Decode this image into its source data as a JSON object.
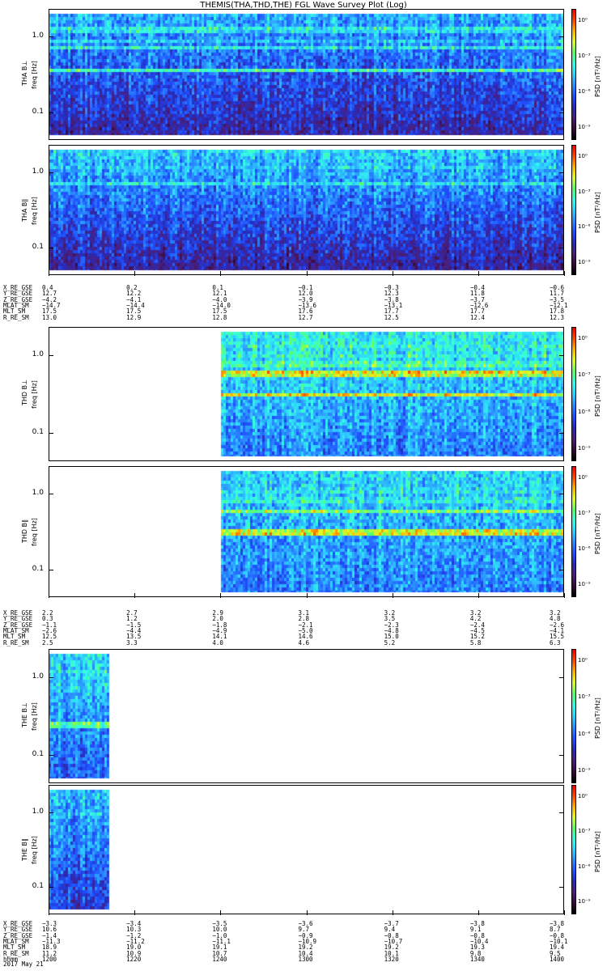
{
  "title": "THEMIS(THA,THD,THE) FGL Wave Survey Plot (Log)",
  "colors": {
    "colormap": [
      "#000000",
      "#3a0a3a",
      "#4b1f7a",
      "#2a2ab8",
      "#1f4fff",
      "#2b8cff",
      "#2fd0ff",
      "#34ffe0",
      "#5cff6a",
      "#d8ff2a",
      "#ffb400",
      "#ff4a00",
      "#ee0000"
    ]
  },
  "chart_data": {
    "type": "heatmap",
    "freq_scale": "log",
    "freq_range_hz": [
      0.05,
      2.0
    ],
    "freq_ticks": [
      {
        "value": 1.0,
        "label": "1.0"
      },
      {
        "value": 0.1,
        "label": "0.1"
      }
    ],
    "colorbar": {
      "label": "PSD [nT²/Hz]",
      "ticks": [
        {
          "value": 1,
          "label": "10⁰"
        },
        {
          "value": 0.001,
          "label": "10⁻³"
        },
        {
          "value": 1e-06,
          "label": "10⁻⁶"
        },
        {
          "value": 1e-09,
          "label": "10⁻⁹"
        }
      ]
    },
    "time_axis": {
      "date": "2017 May 21",
      "labels": [
        "1200",
        "1220",
        "1240",
        "1300",
        "1320",
        "1340",
        "1400"
      ]
    },
    "probes": [
      {
        "name": "THA",
        "panels": [
          {
            "ylabel": "THA B⊥",
            "freq_label": "freq [Hz]",
            "coverage": [
              0.0,
              1.0
            ],
            "bands": [
              {
                "f": 0.38,
                "level": 0.62
              },
              {
                "f": 0.75,
                "level": 0.55
              },
              {
                "f": 1.3,
                "level": 0.58
              },
              {
                "f": 0.9,
                "level": 0.5
              }
            ],
            "base_high": 0.46,
            "base_low": 0.22
          },
          {
            "ylabel": "THA B∥",
            "freq_label": "freq [Hz]",
            "coverage": [
              0.0,
              1.0
            ],
            "bands": [
              {
                "f": 0.75,
                "level": 0.55
              },
              {
                "f": 1.2,
                "level": 0.52
              }
            ],
            "base_high": 0.5,
            "base_low": 0.2
          }
        ],
        "ephemeris": [
          {
            "label": "X_RE_GSE",
            "values": [
              "0.4",
              "0.2",
              "0.1",
              "−0.1",
              "−0.3",
              "−0.4",
              "−0.6"
            ]
          },
          {
            "label": "Y_RE_GSE",
            "values": [
              "12.7",
              "12.2",
              "12.1",
              "12.0",
              "12.3",
              "11.8",
              "11.7"
            ]
          },
          {
            "label": "Z_RE_GSE",
            "values": [
              "−4.2",
              "−4.1",
              "−4.0",
              "−3.9",
              "−3.8",
              "−3.7",
              "−3.5"
            ]
          },
          {
            "label": "MLAT_SM",
            "values": [
              "−14.7",
              "−14.4",
              "−14.0",
              "−13.6",
              "−13.1",
              "−12.6",
              "−12.1"
            ]
          },
          {
            "label": "MLT_SM",
            "values": [
              "17.5",
              "17.5",
              "17.5",
              "17.6",
              "17.7",
              "17.7",
              "17.8"
            ]
          },
          {
            "label": "R_RE_SM",
            "values": [
              "13.0",
              "12.9",
              "12.8",
              "12.7",
              "12.5",
              "12.4",
              "12.3"
            ]
          }
        ]
      },
      {
        "name": "THD",
        "panels": [
          {
            "ylabel": "THD B⊥",
            "freq_label": "freq [Hz]",
            "coverage": [
              0.335,
              1.0
            ],
            "bands": [
              {
                "f": 0.32,
                "level": 0.78
              },
              {
                "f": 0.62,
                "level": 0.8
              },
              {
                "f": 0.8,
                "level": 0.65
              },
              {
                "f": 1.05,
                "level": 0.6
              },
              {
                "f": 1.4,
                "level": 0.6
              }
            ],
            "base_high": 0.56,
            "base_low": 0.4
          },
          {
            "ylabel": "THD B∥",
            "freq_label": "freq [Hz]",
            "coverage": [
              0.335,
              1.0
            ],
            "bands": [
              {
                "f": 0.32,
                "level": 0.8
              },
              {
                "f": 0.62,
                "level": 0.7
              },
              {
                "f": 0.85,
                "level": 0.6
              },
              {
                "f": 1.15,
                "level": 0.58
              }
            ],
            "base_high": 0.52,
            "base_low": 0.4
          }
        ],
        "ephemeris": [
          {
            "label": "X_RE_GSE",
            "values": [
              "2.2",
              "2.7",
              "2.9",
              "3.1",
              "3.2",
              "3.2",
              "3.2"
            ]
          },
          {
            "label": "Y_RE_GSE",
            "values": [
              "0.3",
              "1.2",
              "2.0",
              "2.8",
              "3.5",
              "4.2",
              "4.8"
            ]
          },
          {
            "label": "Z_RE_GSE",
            "values": [
              "−1.1",
              "−1.5",
              "−1.8",
              "−2.1",
              "−2.3",
              "−2.4",
              "−2.6"
            ]
          },
          {
            "label": "MLAT_SM",
            "values": [
              "−2.6",
              "−4.4",
              "−4.9",
              "−5.0",
              "−4.8",
              "−4.5",
              "−4.1"
            ]
          },
          {
            "label": "MLT_SM",
            "values": [
              "12.5",
              "13.5",
              "14.1",
              "14.6",
              "15.0",
              "15.2",
              "15.5"
            ]
          },
          {
            "label": "R_RE_SM",
            "values": [
              "2.5",
              "3.3",
              "4.0",
              "4.6",
              "5.2",
              "5.8",
              "6.3"
            ]
          }
        ]
      },
      {
        "name": "THE",
        "panels": [
          {
            "ylabel": "THE B⊥",
            "freq_label": "freq [Hz]",
            "coverage": [
              0.0,
              0.118
            ],
            "bands": [
              {
                "f": 0.26,
                "level": 0.68
              },
              {
                "f": 0.8,
                "level": 0.55
              },
              {
                "f": 1.25,
                "level": 0.55
              }
            ],
            "base_high": 0.52,
            "base_low": 0.34
          },
          {
            "ylabel": "THE B∥",
            "freq_label": "freq [Hz]",
            "coverage": [
              0.0,
              0.118
            ],
            "bands": [
              {
                "f": 1.0,
                "level": 0.5
              }
            ],
            "base_high": 0.48,
            "base_low": 0.28
          }
        ],
        "ephemeris": [
          {
            "label": "X_RE_GSE",
            "values": [
              "−3.3",
              "−3.4",
              "−3.5",
              "−3.6",
              "−3.7",
              "−3.8",
              "−3.8"
            ]
          },
          {
            "label": "Y_RE_GSE",
            "values": [
              "10.6",
              "10.3",
              "10.0",
              "9.7",
              "9.4",
              "9.1",
              "8.7"
            ]
          },
          {
            "label": "Z_RE_GSE",
            "values": [
              "−1.4",
              "−1.2",
              "−1.0",
              "−0.9",
              "−0.8",
              "−0.8",
              "−0.8"
            ]
          },
          {
            "label": "MLAT_SM",
            "values": [
              "−11.3",
              "−11.2",
              "−11.1",
              "−10.9",
              "−10.7",
              "−10.4",
              "−10.1"
            ]
          },
          {
            "label": "MLT_SM",
            "values": [
              "18.9",
              "19.0",
              "19.1",
              "19.2",
              "19.2",
              "19.3",
              "19.4"
            ]
          },
          {
            "label": "R_RE_SM",
            "values": [
              "11.2",
              "10.9",
              "10.7",
              "10.4",
              "10.1",
              "9.8",
              "9.5"
            ]
          },
          {
            "label": "hhmm",
            "values": [
              "1200",
              "1220",
              "1240",
              "1300",
              "1320",
              "1340",
              "1400"
            ]
          }
        ]
      }
    ]
  }
}
